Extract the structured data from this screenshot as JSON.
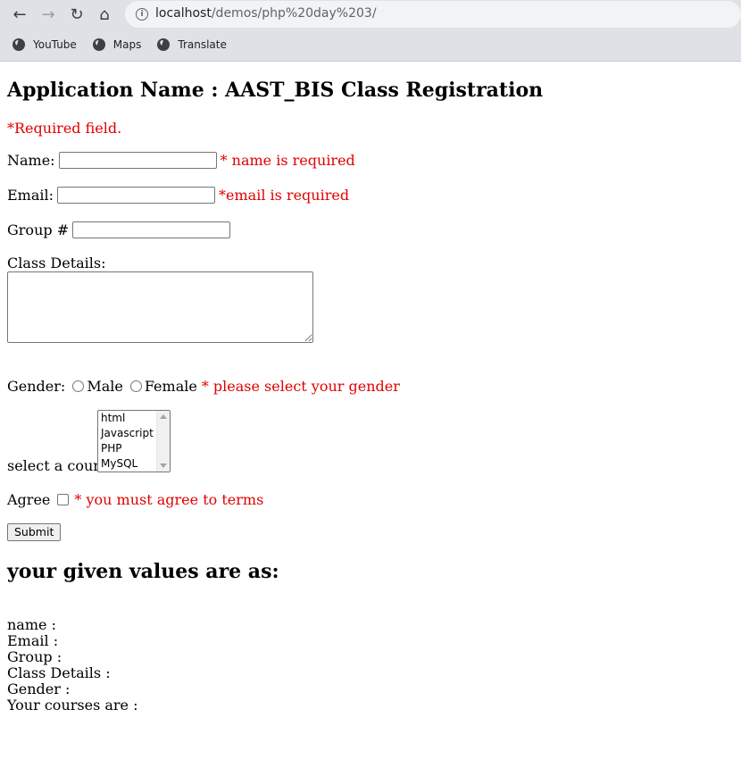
{
  "browser": {
    "url_host": "localhost",
    "url_path": "/demos/php%20day%203/",
    "bookmarks": [
      "YouTube",
      "Maps",
      "Translate"
    ]
  },
  "form": {
    "title": "Application Name : AAST_BIS Class Registration",
    "required_note": "*Required field.",
    "name_label": "Name:",
    "name_error": "* name is required",
    "email_label": "Email:",
    "email_error": "*email is required",
    "group_label": "Group #",
    "class_details_label": "Class Details:",
    "gender_label": "Gender:",
    "gender_male": "Male",
    "gender_female": "Female",
    "gender_error": "* please select your gender",
    "course_label": "select a course:",
    "courses": [
      "html",
      "Javascript",
      "PHP",
      "MySQL"
    ],
    "agree_label": "Agree",
    "agree_error": "* you must agree to terms",
    "submit_label": "Submit"
  },
  "results": {
    "heading": "your given values are as:",
    "name": "name :",
    "email": "Email :",
    "group": "Group :",
    "class_details": "Class Details :",
    "gender": "Gender :",
    "courses": "Your courses are :"
  }
}
